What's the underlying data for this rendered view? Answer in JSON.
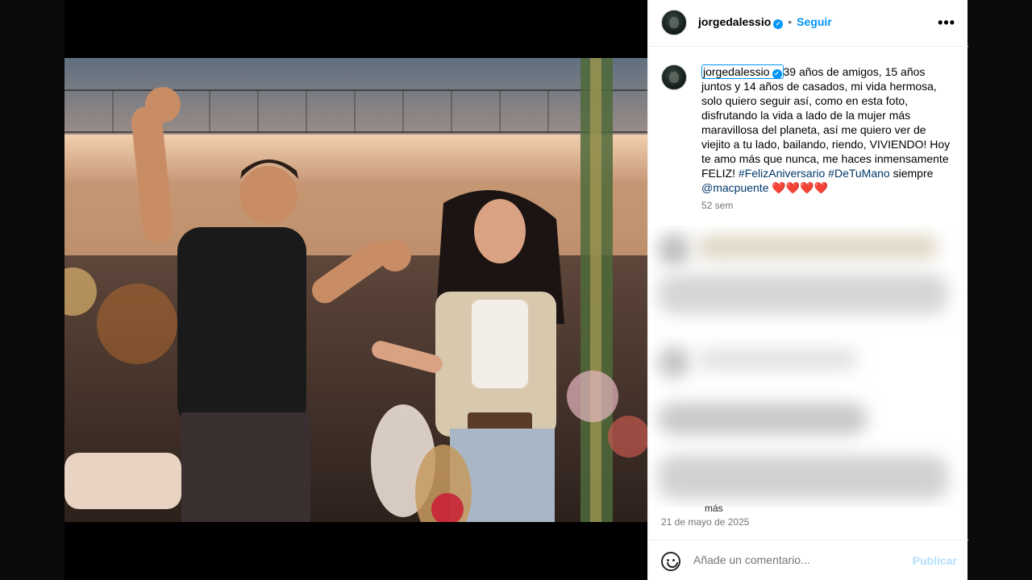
{
  "post": {
    "username": "jorgedalessio",
    "follow_label": "Seguir",
    "dot": "•",
    "more_label": "•••",
    "verified_glyph": "✓"
  },
  "caption": {
    "username": "jorgedalessio",
    "text_1": "39 años de amigos, 15 años juntos y 14 años de casados, mi vida hermosa, solo quiero seguir así, como en esta foto, disfrutando la vida a lado de la mujer más maravillosa del planeta, así me quiero ver de viejito a tu lado, bailando, riendo, VIVIENDO! Hoy te amo más que nunca, me haces inmensamente FELIZ! ",
    "hashtag_1": "#FelizAniversario",
    "hashtag_2": "#DeTuMano",
    "text_2": " siempre",
    "mention": "@macpuente",
    "hearts": "❤️❤️❤️❤️",
    "age": "52 sem"
  },
  "comments_partial": "más",
  "date": "21 de mayo de 2025",
  "comment_box": {
    "placeholder": "Añade un comentario...",
    "publish_label": "Publicar"
  },
  "colors": {
    "accent": "#0095f6",
    "link": "#00376b",
    "muted": "#737373"
  },
  "icons": [
    "emoji-icon",
    "verified-badge-icon",
    "more-options-icon"
  ]
}
